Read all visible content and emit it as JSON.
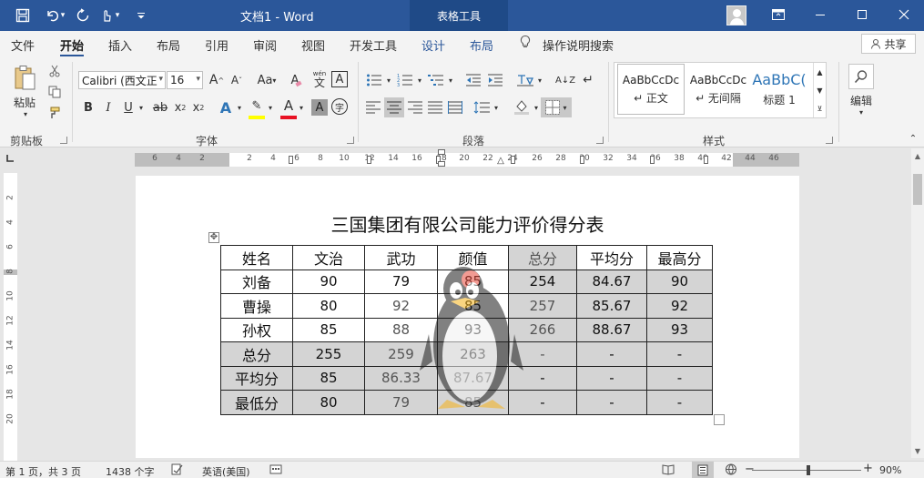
{
  "title_bar": {
    "document_title": "文档1  -  Word",
    "context_tab": "表格工具",
    "quick_access": [
      "save-icon",
      "undo-icon",
      "redo-icon",
      "touch-mode-icon",
      "customize-icon"
    ],
    "window_buttons": [
      "ribbon-display-icon",
      "minimize-icon",
      "maximize-icon",
      "close-icon"
    ]
  },
  "tabs": [
    "文件",
    "开始",
    "插入",
    "布局",
    "引用",
    "审阅",
    "视图",
    "开发工具",
    "设计",
    "布局",
    "操作说明搜索"
  ],
  "active_tab": "开始",
  "share_label": "共享",
  "ribbon": {
    "clipboard": {
      "paste": "粘贴",
      "group": "剪贴板"
    },
    "font": {
      "font_name": "Calibri (西文正",
      "font_size": "16",
      "group": "字体",
      "grow": "A",
      "shrink": "A",
      "case": "Aa",
      "clear": "A",
      "phonetic_top": "wén",
      "phonetic_bottom": "文",
      "border_char": "A",
      "bold": "B",
      "italic": "I",
      "underline": "U",
      "strike": "ab",
      "subscript": "x",
      "superscript": "x",
      "effects": "A",
      "highlight": "✎",
      "font_color": "A",
      "shade_char": "A",
      "enclose": "字",
      "highlight_color": "#ffff00",
      "font_color_value": "#e81123"
    },
    "paragraph": {
      "group": "段落",
      "sort": "A↓Z",
      "wrap": "↵"
    },
    "styles": {
      "group": "样式",
      "items": [
        {
          "preview": "AaBbCcDc",
          "name": "↵ 正文"
        },
        {
          "preview": "AaBbCcDc",
          "name": "↵ 无间隔"
        },
        {
          "preview": "AaBbC(",
          "name": "标题 1"
        }
      ]
    },
    "editing": {
      "label": "编辑"
    }
  },
  "ruler": {
    "horizontal": [
      "6",
      "4",
      "2",
      "2",
      "4",
      "6",
      "8",
      "10",
      "12",
      "14",
      "16",
      "18",
      "20",
      "22",
      "24",
      "26",
      "28",
      "30",
      "32",
      "34",
      "36",
      "38",
      "40",
      "42",
      "44",
      "46"
    ],
    "vertical": [
      "2",
      "4",
      "6",
      "8",
      "10",
      "12",
      "14",
      "16",
      "18",
      "20"
    ]
  },
  "document": {
    "heading": "三国集团有限公司能力评价得分表",
    "table": {
      "headers": [
        "姓名",
        "文治",
        "武功",
        "颜值",
        "总分",
        "平均分",
        "最高分"
      ],
      "rows": [
        [
          "刘备",
          "90",
          "79",
          "85",
          "254",
          "84.67",
          "90"
        ],
        [
          "曹操",
          "80",
          "92",
          "85",
          "257",
          "85.67",
          "92"
        ],
        [
          "孙权",
          "85",
          "88",
          "93",
          "266",
          "88.67",
          "93"
        ],
        [
          "总分",
          "255",
          "259",
          "263",
          "-",
          "-",
          "-"
        ],
        [
          "平均分",
          "85",
          "86.33",
          "87.67",
          "-",
          "-",
          "-"
        ],
        [
          "最低分",
          "80",
          "79",
          "85",
          "-",
          "-",
          "-"
        ]
      ]
    }
  },
  "status_bar": {
    "page_info": "第 1 页，共 3 页",
    "word_count": "1438 个字",
    "language": "英语(美国)",
    "zoom": "90%"
  },
  "colors": {
    "title_bar": "#2b579a",
    "context_tab": "#1f4a87",
    "table_shade": "#d4d4d4",
    "ruler_grey": "#bdbdbd"
  }
}
